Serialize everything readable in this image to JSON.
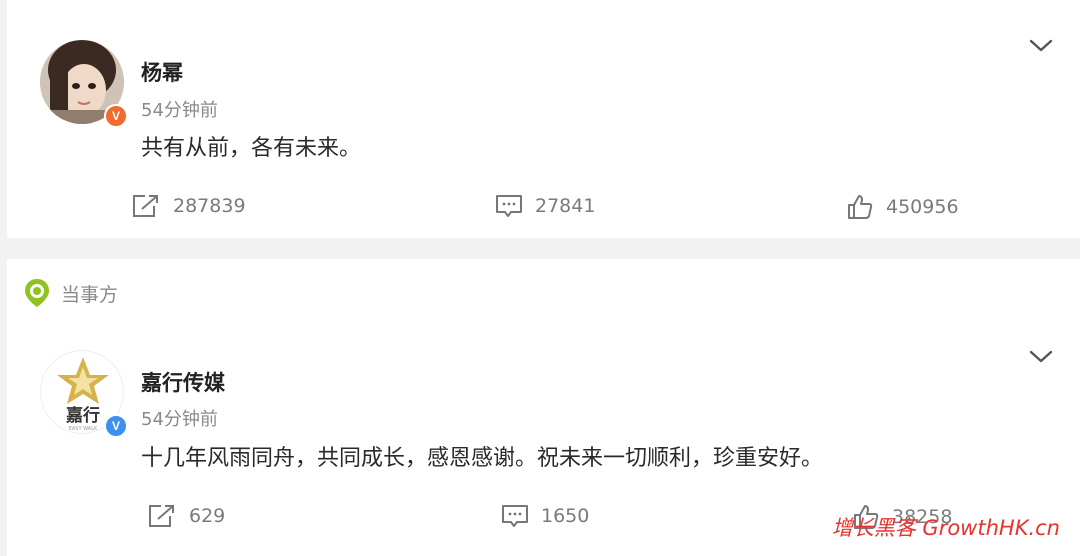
{
  "posts": [
    {
      "author": "杨幂",
      "time": "54分钟前",
      "content": "共有从前，各有未来。",
      "badge": "V",
      "badge_color": "#f26a2e",
      "share_count": "287839",
      "comment_count": "27841",
      "like_count": "450956"
    },
    {
      "author": "嘉行传媒",
      "time": "54分钟前",
      "content": "十几年风雨同舟，共同成长，感恩感谢。祝未来一切顺利，珍重安好。",
      "badge": "V",
      "badge_color": "#3d8ff0",
      "logo_text": "嘉行",
      "logo_subtext": "EASY WALK",
      "share_count": "629",
      "comment_count": "1650",
      "like_count": "38258"
    }
  ],
  "section_label": "当事方",
  "watermark": "增长黑客 GrowthHK.cn",
  "colors": {
    "accent_green": "#8fc31f",
    "watermark_red": "#e8322f"
  }
}
